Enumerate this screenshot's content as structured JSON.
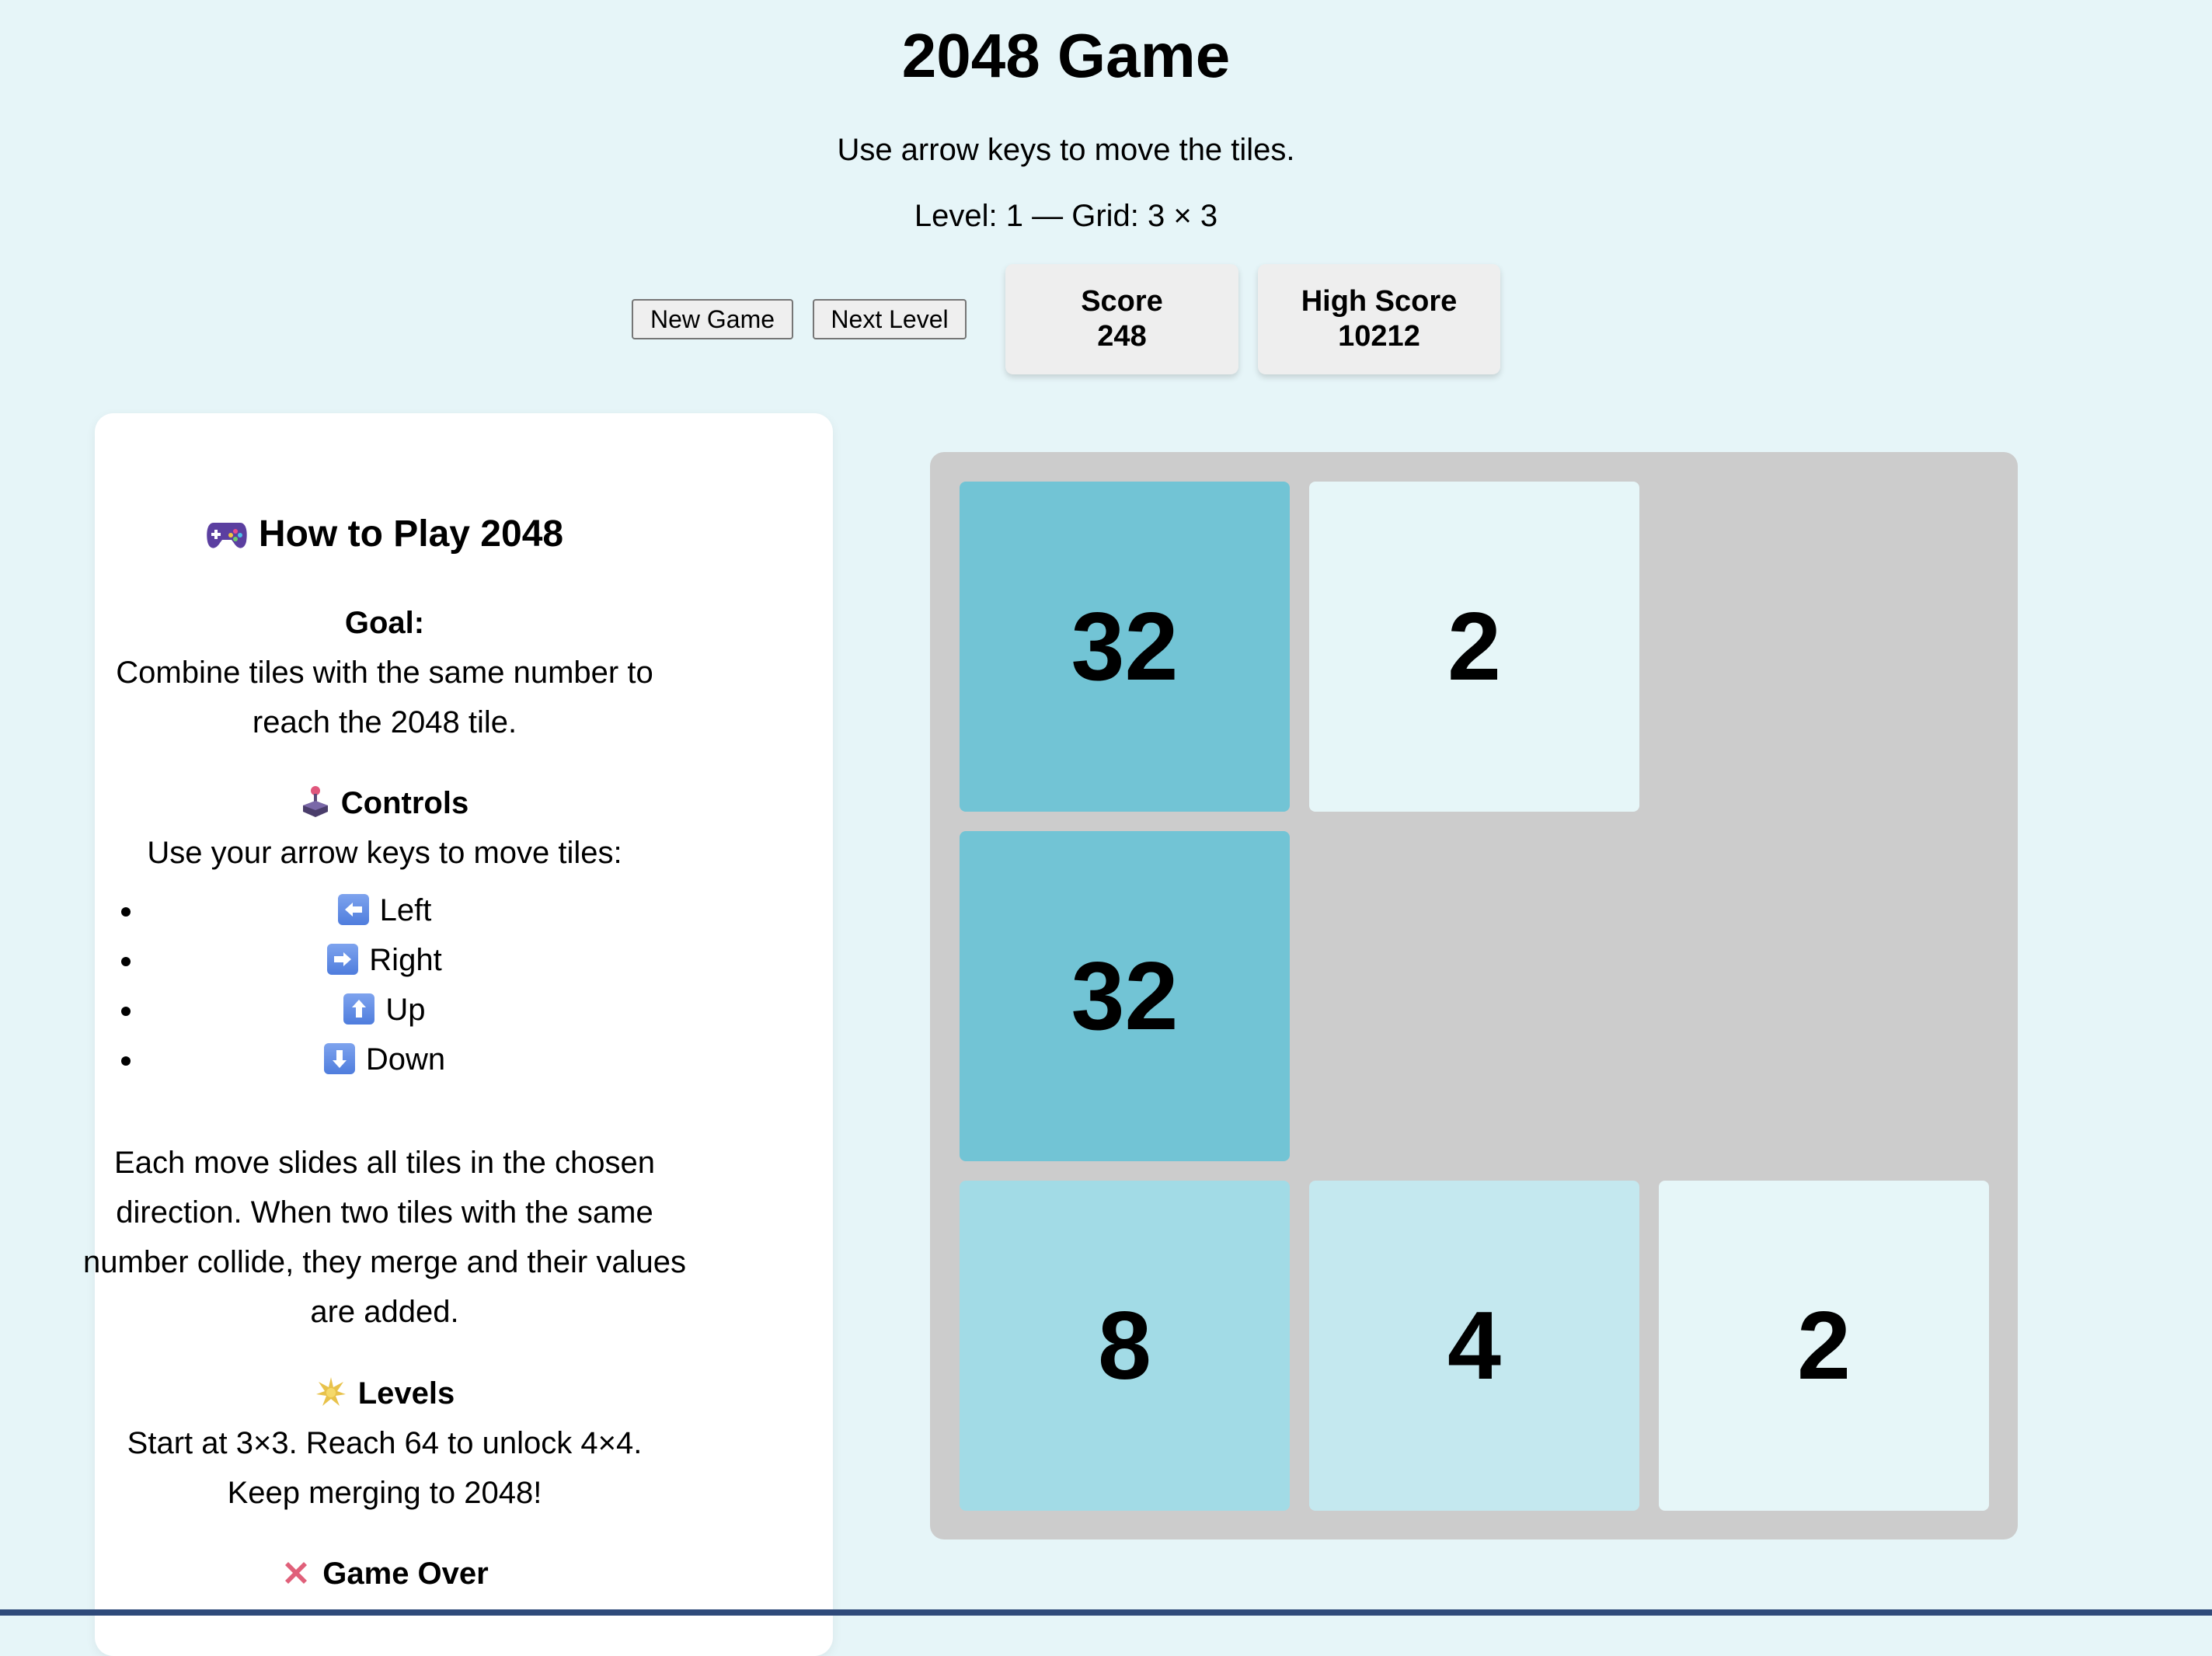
{
  "header": {
    "title": "2048 Game",
    "subtitle": "Use arrow keys to move the tiles.",
    "level_info": "Level: 1 — Grid: 3 × 3"
  },
  "toolbar": {
    "new_game_label": "New Game",
    "next_level_label": "Next Level"
  },
  "scores": {
    "score_label": "Score",
    "score_value": "248",
    "high_score_label": "High Score",
    "high_score_value": "10212"
  },
  "instructions": {
    "title": "How to Play 2048",
    "title_icon": "game-controller-icon",
    "goal_heading": "Goal:",
    "goal_line1": "Combine tiles with the same number to",
    "goal_line2": "reach the 2048 tile.",
    "controls_heading": "Controls",
    "controls_icon": "joystick-icon",
    "controls_intro": "Use your arrow keys to move tiles:",
    "controls": [
      {
        "label": "Left",
        "icon": "left-arrow-key-icon"
      },
      {
        "label": "Right",
        "icon": "right-arrow-key-icon"
      },
      {
        "label": "Up",
        "icon": "up-arrow-key-icon"
      },
      {
        "label": "Down",
        "icon": "down-arrow-key-icon"
      }
    ],
    "move_text_line1": "Each move slides all tiles in the chosen",
    "move_text_line2": "direction. When two tiles with the same",
    "move_text_line3": "number collide, they merge and their values",
    "move_text_line4": "are added.",
    "levels_heading": "Levels",
    "levels_icon": "sparkle-icon",
    "levels_line1": "Start at 3×3. Reach 64 to unlock 4×4.",
    "levels_line2": "Keep merging to 2048!",
    "gameover_heading": "Game Over",
    "gameover_icon": "cross-mark-icon"
  },
  "board": {
    "size": 3,
    "cells": [
      [
        32,
        2,
        null
      ],
      [
        32,
        null,
        null
      ],
      [
        8,
        4,
        2
      ]
    ]
  },
  "colors": {
    "page_background": "#e6f5f8",
    "board_background": "#cccccc",
    "tile_2": "#e6f6f8",
    "tile_4": "#c4e8ef",
    "tile_8": "#a2dbe6",
    "tile_32": "#72c4d5"
  }
}
